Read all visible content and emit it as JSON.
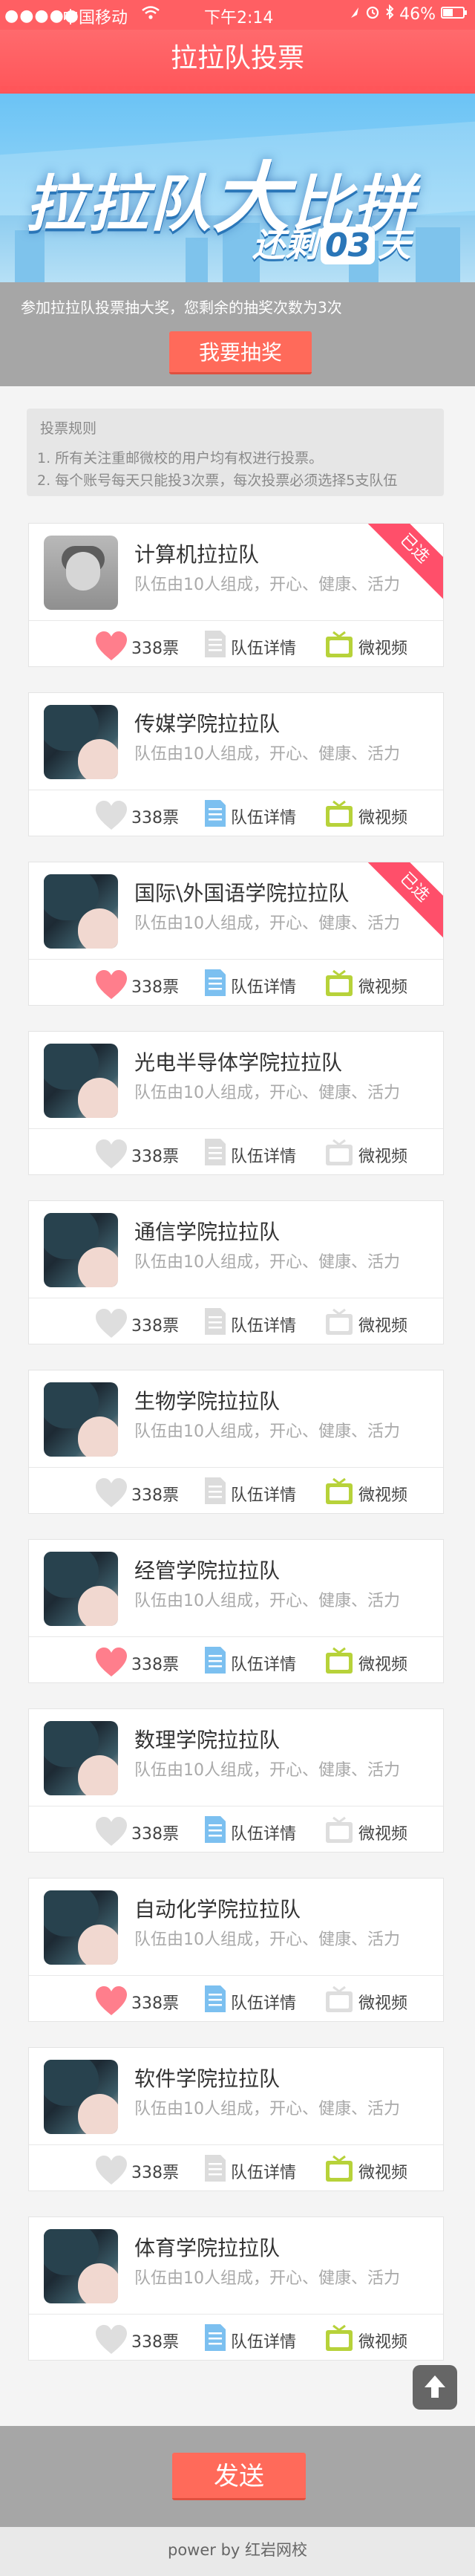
{
  "status_bar": {
    "signal": "●●●●●",
    "carrier": "中国移动",
    "time": "下午2:14",
    "battery": "46%"
  },
  "header": {
    "title": "拉拉队投票"
  },
  "banner": {
    "headline_left": "拉拉队",
    "headline_big": "大",
    "headline_right": "比拼",
    "countdown_prefix": "还剩",
    "countdown_days": "03",
    "countdown_suffix": "天"
  },
  "lottery": {
    "tip": "参加拉拉队投票抽大奖，您剩余的抽奖次数为3次",
    "button": "我要抽奖"
  },
  "rules": {
    "title": "投票规则",
    "items": [
      "1. 所有关注重邮微校的用户均有权进行投票。",
      "2. 每个账号每天只能投3次票，每次投票必须选择5支队伍"
    ]
  },
  "teams": [
    {
      "name": "计算机拉拉队",
      "desc": "队伍由10人组成，开心、健康、活力",
      "votes": "338票",
      "detail": "队伍详情",
      "video": "微视频",
      "selected": true,
      "ribbon": "已选",
      "liked": true,
      "doc_active": false,
      "video_active": true,
      "avatar": "gray"
    },
    {
      "name": "传媒学院拉拉队",
      "desc": "队伍由10人组成，开心、健康、活力",
      "votes": "338票",
      "detail": "队伍详情",
      "video": "微视频",
      "selected": false,
      "ribbon": "",
      "liked": false,
      "doc_active": true,
      "video_active": true,
      "avatar": "anime"
    },
    {
      "name": "国际\\外国语学院拉拉队",
      "desc": "队伍由10人组成，开心、健康、活力",
      "votes": "338票",
      "detail": "队伍详情",
      "video": "微视频",
      "selected": true,
      "ribbon": "已选",
      "liked": true,
      "doc_active": true,
      "video_active": true,
      "avatar": "anime"
    },
    {
      "name": "光电半导体学院拉拉队",
      "desc": "队伍由10人组成，开心、健康、活力",
      "votes": "338票",
      "detail": "队伍详情",
      "video": "微视频",
      "selected": false,
      "ribbon": "",
      "liked": false,
      "doc_active": false,
      "video_active": false,
      "avatar": "anime"
    },
    {
      "name": "通信学院拉拉队",
      "desc": "队伍由10人组成，开心、健康、活力",
      "votes": "338票",
      "detail": "队伍详情",
      "video": "微视频",
      "selected": false,
      "ribbon": "",
      "liked": false,
      "doc_active": false,
      "video_active": false,
      "avatar": "anime"
    },
    {
      "name": "生物学院拉拉队",
      "desc": "队伍由10人组成，开心、健康、活力",
      "votes": "338票",
      "detail": "队伍详情",
      "video": "微视频",
      "selected": false,
      "ribbon": "",
      "liked": false,
      "doc_active": false,
      "video_active": true,
      "avatar": "anime"
    },
    {
      "name": "经管学院拉拉队",
      "desc": "队伍由10人组成，开心、健康、活力",
      "votes": "338票",
      "detail": "队伍详情",
      "video": "微视频",
      "selected": false,
      "ribbon": "",
      "liked": true,
      "doc_active": true,
      "video_active": true,
      "avatar": "anime"
    },
    {
      "name": "数理学院拉拉队",
      "desc": "队伍由10人组成，开心、健康、活力",
      "votes": "338票",
      "detail": "队伍详情",
      "video": "微视频",
      "selected": false,
      "ribbon": "",
      "liked": false,
      "doc_active": true,
      "video_active": false,
      "avatar": "anime"
    },
    {
      "name": "自动化学院拉拉队",
      "desc": "队伍由10人组成，开心、健康、活力",
      "votes": "338票",
      "detail": "队伍详情",
      "video": "微视频",
      "selected": false,
      "ribbon": "",
      "liked": true,
      "doc_active": true,
      "video_active": false,
      "avatar": "anime"
    },
    {
      "name": "软件学院拉拉队",
      "desc": "队伍由10人组成，开心、健康、活力",
      "votes": "338票",
      "detail": "队伍详情",
      "video": "微视频",
      "selected": false,
      "ribbon": "",
      "liked": false,
      "doc_active": false,
      "video_active": true,
      "avatar": "anime"
    },
    {
      "name": "体育学院拉拉队",
      "desc": "队伍由10人组成，开心、健康、活力",
      "votes": "338票",
      "detail": "队伍详情",
      "video": "微视频",
      "selected": false,
      "ribbon": "",
      "liked": false,
      "doc_active": true,
      "video_active": true,
      "avatar": "anime"
    }
  ],
  "footer": {
    "send": "发送",
    "powered": "power by 红岩网校"
  },
  "icons": {
    "heart": "heart-icon",
    "document": "document-icon",
    "tv": "tv-icon",
    "to_top": "arrow-up-icon",
    "wifi": "wifi-icon",
    "alarm": "alarm-icon",
    "battery": "battery-icon"
  },
  "colors": {
    "header": "#ff5f63",
    "heart_on": "#ff7e8c",
    "heart_off": "#dedede",
    "doc_on": "#7cc0f0",
    "doc_off": "#dcdcdc",
    "tv_on": "#b7d23a",
    "tv_off": "#dedede",
    "ribbon": "#ff4f6a",
    "button": "#ff6a5a"
  }
}
